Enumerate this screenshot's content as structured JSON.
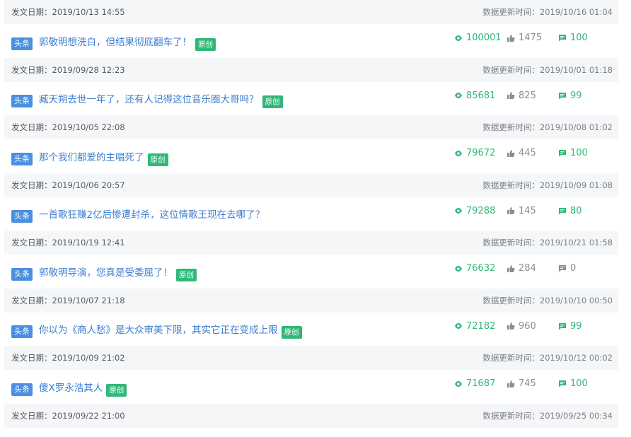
{
  "labels": {
    "publish_prefix": "发文日期：",
    "updated_prefix": "数据更新时间：",
    "toutiao_tag": "头条",
    "original_badge": "原创"
  },
  "colors": {
    "accent_green": "#2fb877",
    "tag_blue": "#4a8fe0",
    "title_blue": "#3b7dd1",
    "muted_gray": "#888d96"
  },
  "icons": {
    "views": "eye-icon",
    "likes": "thumbs-up-icon",
    "comments": "comment-icon"
  },
  "items": [
    {
      "publish_date": "2019/10/13 14:55",
      "updated_time": "2019/10/16 01:04",
      "title": "郭敬明想洗白，但结果彻底翻车了！",
      "original": true,
      "views": "100001",
      "likes": "1475",
      "comments": "100"
    },
    {
      "publish_date": "2019/09/28 12:23",
      "updated_time": "2019/10/01 01:18",
      "title": "臧天朔去世一年了，还有人记得这位音乐圈大哥吗？",
      "original": true,
      "views": "85681",
      "likes": "825",
      "comments": "99"
    },
    {
      "publish_date": "2019/10/05 22:08",
      "updated_time": "2019/10/08 01:02",
      "title": "那个我们都爱的主唱死了",
      "original": true,
      "views": "79672",
      "likes": "445",
      "comments": "100"
    },
    {
      "publish_date": "2019/10/06 20:57",
      "updated_time": "2019/10/09 01:08",
      "title": "一首歌狂赚2亿后惨遭封杀，这位情歌王现在去哪了？",
      "original": false,
      "views": "79288",
      "likes": "145",
      "comments": "80"
    },
    {
      "publish_date": "2019/10/19 12:41",
      "updated_time": "2019/10/21 01:58",
      "title": "郭敬明导演，您真是受委屈了！",
      "original": true,
      "views": "76632",
      "likes": "284",
      "comments": "0"
    },
    {
      "publish_date": "2019/10/07 21:18",
      "updated_time": "2019/10/10 00:50",
      "title": "你以为《商人愁》是大众审美下限，其实它正在变成上限",
      "original": true,
      "views": "72182",
      "likes": "960",
      "comments": "99"
    },
    {
      "publish_date": "2019/10/09 21:02",
      "updated_time": "2019/10/12 00:02",
      "title": "傻X罗永浩其人",
      "original": true,
      "views": "71687",
      "likes": "745",
      "comments": "100"
    },
    {
      "publish_date": "2019/09/22 21:00",
      "updated_time": "2019/09/25 00:34"
    }
  ]
}
